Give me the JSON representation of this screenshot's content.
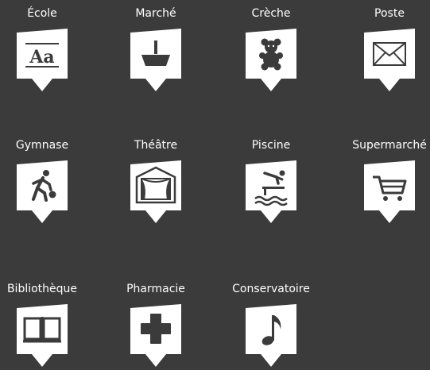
{
  "pois": [
    {
      "label": "École",
      "icon": "school-icon"
    },
    {
      "label": "Marché",
      "icon": "market-icon"
    },
    {
      "label": "Crèche",
      "icon": "nursery-icon"
    },
    {
      "label": "Poste",
      "icon": "post-office-icon"
    },
    {
      "label": "Gymnase",
      "icon": "gymnasium-icon"
    },
    {
      "label": "Théâtre",
      "icon": "theatre-icon"
    },
    {
      "label": "Piscine",
      "icon": "swimming-pool-icon"
    },
    {
      "label": "Supermarché",
      "icon": "supermarket-icon"
    },
    {
      "label": "Bibliothèque",
      "icon": "library-icon"
    },
    {
      "label": "Pharmacie",
      "icon": "pharmacy-icon"
    },
    {
      "label": "Conservatoire",
      "icon": "conservatory-icon"
    }
  ],
  "colors": {
    "background": "#3b3b3b",
    "marker": "#ffffff",
    "glyph": "#3b3b3b"
  }
}
